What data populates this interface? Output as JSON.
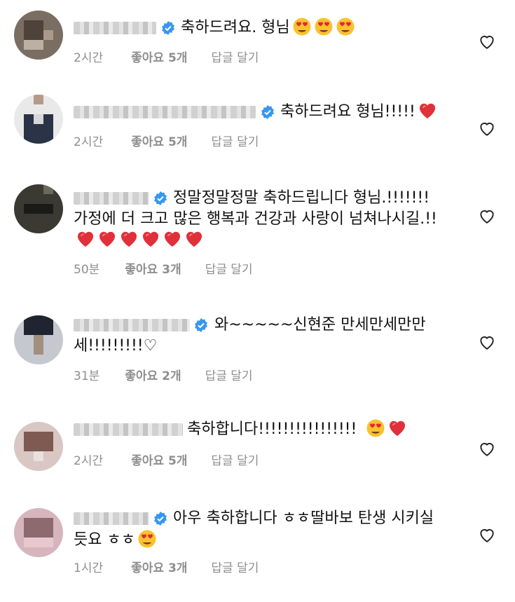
{
  "comments": [
    {
      "text_lines": [
        "축하드려요. 형님"
      ],
      "emojis": [
        "heart-eyes",
        "heart-eyes",
        "heart-eyes"
      ],
      "time": "2시간",
      "likes": "좋아요 5개",
      "reply": "답글 달기"
    },
    {
      "text_lines": [
        "축하드려요 형님!!!!!"
      ],
      "emojis": [
        "red-heart"
      ],
      "time": "2시간",
      "likes": "좋아요 5개",
      "reply": "답글 달기"
    },
    {
      "text_lines": [
        "정말정말정말 축하드립니다 형님.!!!!!!!",
        "가정에 더 크고 많은 행복과 건강과 사랑이 넘쳐나시길.!!"
      ],
      "emojis": [
        "red-heart",
        "red-heart",
        "red-heart",
        "red-heart",
        "red-heart",
        "red-heart"
      ],
      "time": "50분",
      "likes": "좋아요 3개",
      "reply": "답글 달기"
    },
    {
      "text_lines": [
        "와~~~~~신현준 만세만세만만",
        "세!!!!!!!!!♡"
      ],
      "emojis": [],
      "time": "31분",
      "likes": "좋아요 2개",
      "reply": "답글 달기"
    },
    {
      "text_lines": [
        "축하합니다!!!!!!!!!!!!!!!!"
      ],
      "emojis": [
        "heart-eyes",
        "red-heart"
      ],
      "time": "2시간",
      "likes": "좋아요 5개",
      "reply": "답글 달기"
    },
    {
      "text_lines": [
        "아우 축하합니다 ㅎㅎ딸바보 탄생 시키실",
        "듯요 ㅎㅎ"
      ],
      "emojis": [
        "heart-eyes"
      ],
      "time": "1시간",
      "likes": "좋아요 3개",
      "reply": "답글 달기"
    }
  ],
  "colors": {
    "verified": "#3797f0",
    "meta": "#8e8e8e",
    "heart_red": "#e0303a",
    "text": "#111111"
  }
}
